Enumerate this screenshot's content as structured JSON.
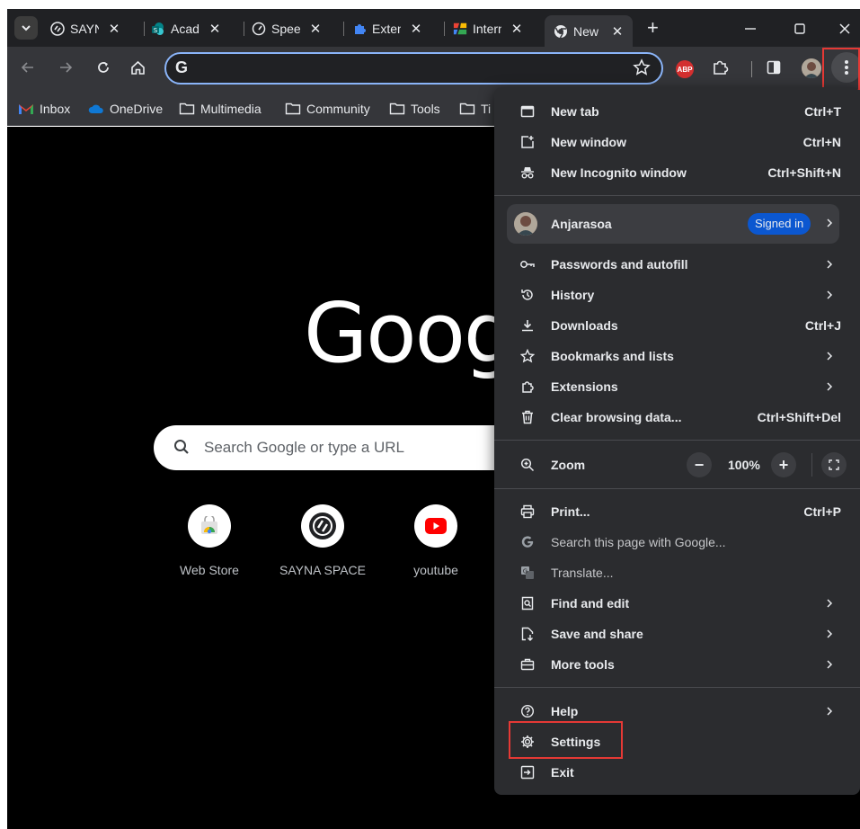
{
  "tabs": [
    {
      "title": "SAYN",
      "icon": "sayna-icon"
    },
    {
      "title": "Acad",
      "icon": "sharepoint-icon"
    },
    {
      "title": "Spee",
      "icon": "speedometer-icon"
    },
    {
      "title": "Exten",
      "icon": "puzzle-icon"
    },
    {
      "title": "Intern",
      "icon": "colorful-icon"
    },
    {
      "title": "New",
      "icon": "chrome-icon",
      "active": true
    }
  ],
  "close_glyph": "✕",
  "new_tab_glyph": "+",
  "omnibox": {
    "value": "",
    "g_letter": "G"
  },
  "extensions": {
    "abp_label": "ABP"
  },
  "bookmarks": [
    {
      "label": "Inbox",
      "icon": "gmail-icon"
    },
    {
      "label": "OneDrive",
      "icon": "onedrive-icon"
    },
    {
      "label": "Multimedia",
      "icon": "folder-icon"
    },
    {
      "label": "Community",
      "icon": "folder-icon"
    },
    {
      "label": "Tools",
      "icon": "folder-icon"
    },
    {
      "label": "Ti",
      "icon": "folder-icon"
    }
  ],
  "ntp": {
    "logo_text": "Goog",
    "search_placeholder": "Search Google or type a URL",
    "shortcuts": [
      {
        "label": "Web Store"
      },
      {
        "label": "SAYNA SPACE"
      },
      {
        "label": "youtube"
      }
    ]
  },
  "menu": {
    "new_tab": {
      "label": "New tab",
      "shortcut": "Ctrl+T"
    },
    "new_window": {
      "label": "New window",
      "shortcut": "Ctrl+N"
    },
    "new_incognito": {
      "label": "New Incognito window",
      "shortcut": "Ctrl+Shift+N"
    },
    "profile": {
      "name": "Anjarasoa",
      "badge": "Signed in"
    },
    "passwords": {
      "label": "Passwords and autofill"
    },
    "history": {
      "label": "History"
    },
    "downloads": {
      "label": "Downloads",
      "shortcut": "Ctrl+J"
    },
    "bookmarks": {
      "label": "Bookmarks and lists"
    },
    "extensions": {
      "label": "Extensions"
    },
    "clear_data": {
      "label": "Clear browsing data...",
      "shortcut": "Ctrl+Shift+Del"
    },
    "zoom": {
      "label": "Zoom",
      "value": "100%",
      "minus": "−",
      "plus": "+"
    },
    "print": {
      "label": "Print...",
      "shortcut": "Ctrl+P"
    },
    "search_page": {
      "label": "Search this page with Google..."
    },
    "translate": {
      "label": "Translate..."
    },
    "find_edit": {
      "label": "Find and edit"
    },
    "save_share": {
      "label": "Save and share"
    },
    "more_tools": {
      "label": "More tools"
    },
    "help": {
      "label": "Help"
    },
    "settings": {
      "label": "Settings"
    },
    "exit": {
      "label": "Exit"
    }
  },
  "colors": {
    "accent": "#8ab4f8",
    "highlight": "#e53935",
    "badge": "#0b57d0"
  }
}
